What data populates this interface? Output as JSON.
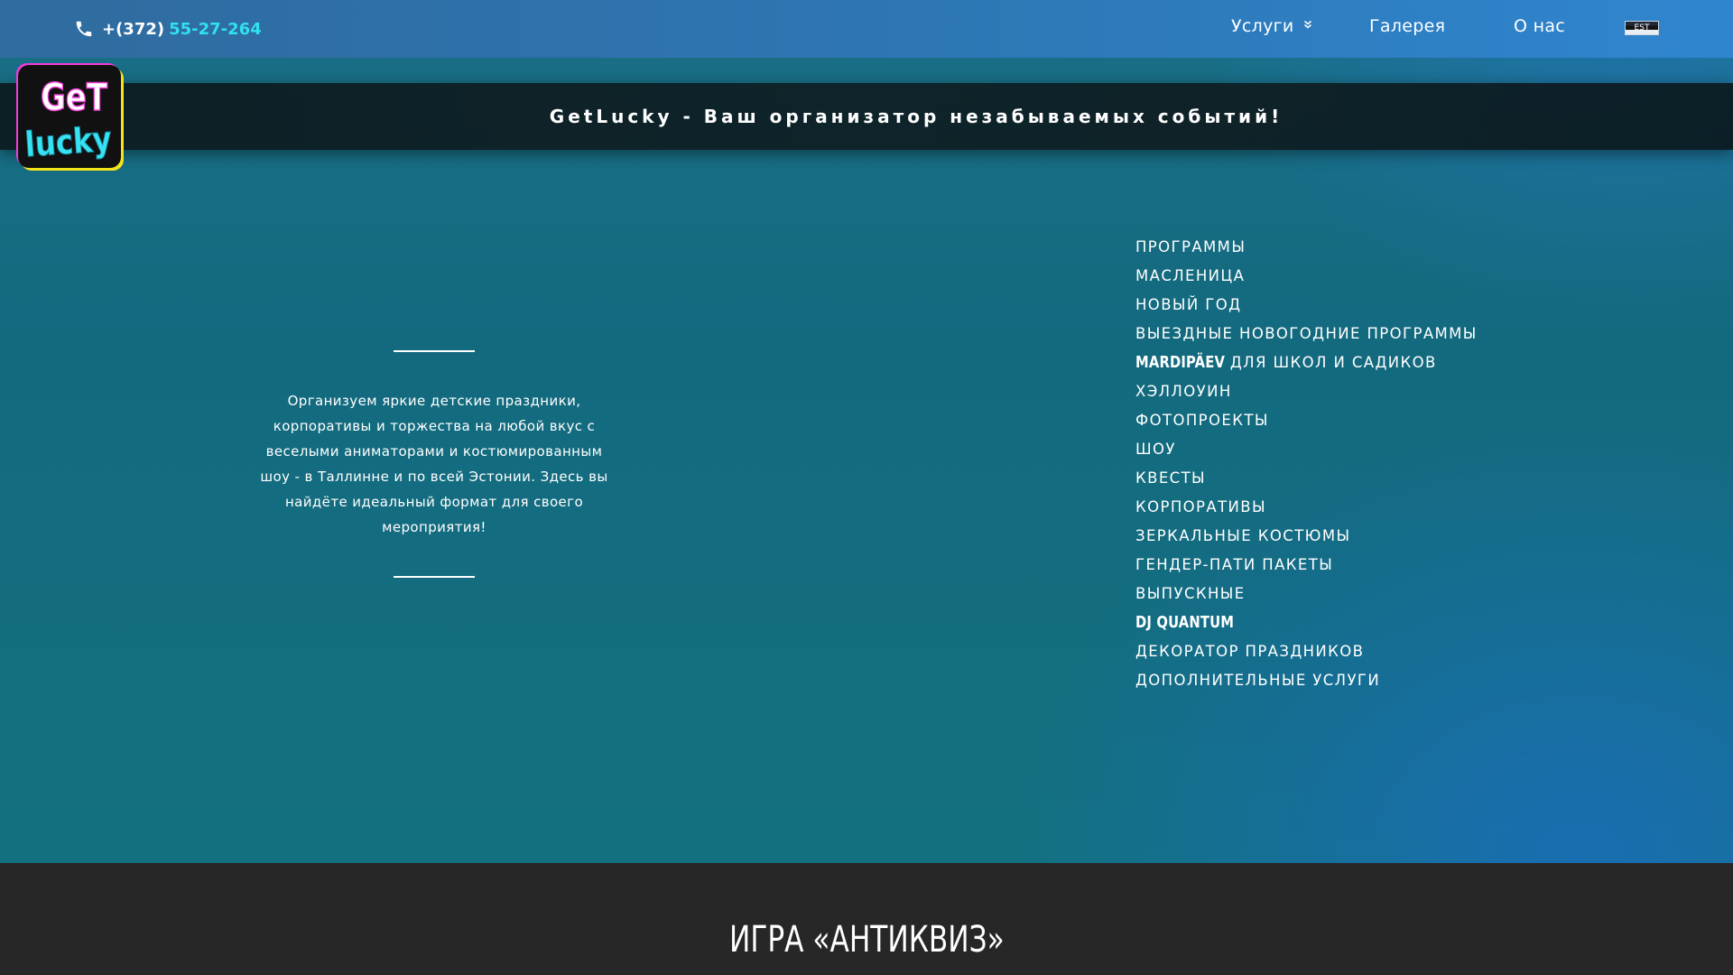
{
  "topbar": {
    "phone_prefix": "+(372)",
    "phone_number": "55-27-264",
    "nav": {
      "services": "Услуги",
      "gallery": "Галерея",
      "about": "О нас"
    },
    "language": "EST"
  },
  "logo": {
    "line1": "GeT",
    "line2": "lucky"
  },
  "banner": {
    "text": "GetLucky - Ваш организатор незабываемых событий!"
  },
  "about": {
    "text": "Организуем яркие детские праздники, корпоративы и торжества на любой вкус с веселыми аниматорами и костюмированным шоу - в Таллинне и по всей Эстонии. Здесь вы найдёте идеальный формат для своего мероприятия!"
  },
  "services": {
    "items": [
      {
        "label": "ПРОГРАММЫ"
      },
      {
        "label": "МАСЛЕНИЦА"
      },
      {
        "label": "НОВЫЙ ГОД"
      },
      {
        "label": "ВЫЕЗДНЫЕ НОВОГОДНИЕ ПРОГРАММЫ"
      },
      {
        "brand": "MARDIPÄEV",
        "label": "ДЛЯ ШКОЛ И САДИКОВ"
      },
      {
        "label": "ХЭЛЛОУИН"
      },
      {
        "label": "ФОТОПРОЕКТЫ"
      },
      {
        "label": "ШОУ"
      },
      {
        "label": "КВЕСТЫ"
      },
      {
        "label": "КОРПОРАТИВЫ"
      },
      {
        "label": "ЗЕРКАЛЬНЫЕ КОСТЮМЫ"
      },
      {
        "label": "ГЕНДЕР-ПАТИ ПАКЕТЫ"
      },
      {
        "label": "ВЫПУСКНЫЕ"
      },
      {
        "brand": "DJ QUANTUM"
      },
      {
        "label": "ДЕКОРАТОР ПРАЗДНИКОВ"
      },
      {
        "label": "ДОПОЛНИТЕЛЬНЫЕ УСЛУГИ"
      }
    ]
  },
  "section": {
    "title": "ИГРА «АНТИКВИЗ»"
  },
  "colors": {
    "accent_phone": "#32e0f0",
    "dark_section": "#272727",
    "logo_yellow": "#f4e21a",
    "logo_pink": "#f13cd8",
    "logo_cyan": "#35e3f2"
  }
}
